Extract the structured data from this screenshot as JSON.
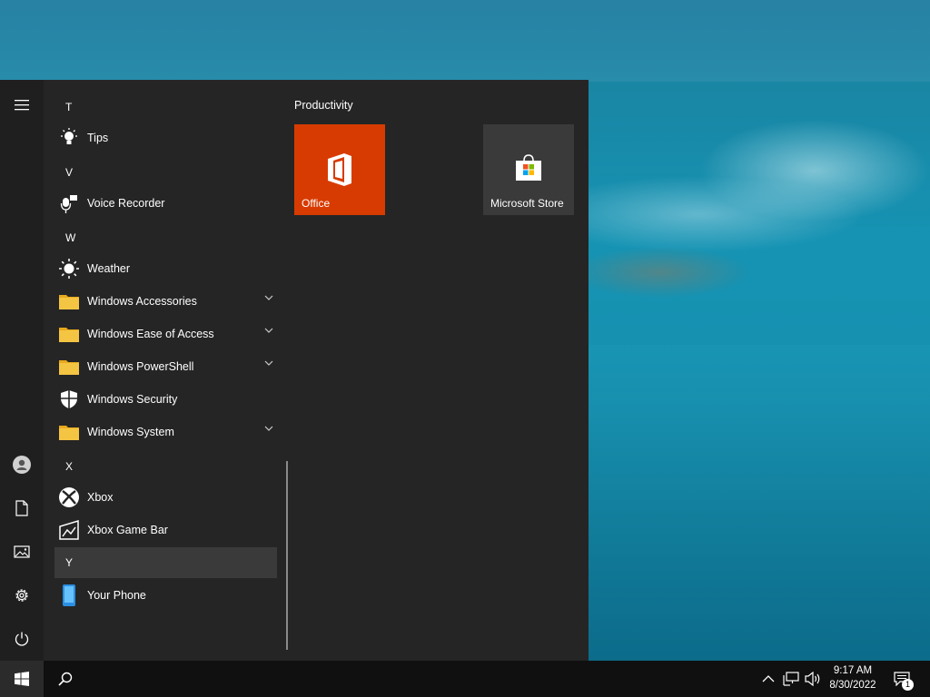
{
  "start_menu": {
    "app_list": [
      {
        "type": "letter",
        "text": "T"
      },
      {
        "type": "app",
        "label": "Tips",
        "icon": "lightbulb-icon"
      },
      {
        "type": "letter",
        "text": "V"
      },
      {
        "type": "app",
        "label": "Voice Recorder",
        "icon": "microphone-icon"
      },
      {
        "type": "letter",
        "text": "W"
      },
      {
        "type": "app",
        "label": "Weather",
        "icon": "sun-icon"
      },
      {
        "type": "folder",
        "label": "Windows Accessories",
        "icon": "folder-icon"
      },
      {
        "type": "folder",
        "label": "Windows Ease of Access",
        "icon": "folder-icon"
      },
      {
        "type": "folder",
        "label": "Windows PowerShell",
        "icon": "folder-icon"
      },
      {
        "type": "app",
        "label": "Windows Security",
        "icon": "shield-icon"
      },
      {
        "type": "folder",
        "label": "Windows System",
        "icon": "folder-icon"
      },
      {
        "type": "letter",
        "text": "X"
      },
      {
        "type": "app",
        "label": "Xbox",
        "icon": "xbox-icon"
      },
      {
        "type": "app",
        "label": "Xbox Game Bar",
        "icon": "game-bar-icon"
      },
      {
        "type": "letter",
        "text": "Y",
        "highlighted": true
      },
      {
        "type": "app",
        "label": "Your Phone",
        "icon": "phone-icon"
      }
    ],
    "tiles_group": {
      "title": "Productivity",
      "tiles": [
        {
          "label": "Office",
          "color": "#d83b01",
          "icon": "office-icon"
        },
        {
          "label": "Microsoft Store",
          "color": "#3a3a3a",
          "icon": "store-bag-icon"
        }
      ]
    },
    "rail_icons": [
      "hamburger-menu-icon",
      "user-account-icon",
      "documents-icon",
      "pictures-icon",
      "settings-gear-icon",
      "power-icon"
    ]
  },
  "taskbar": {
    "time": "9:17 AM",
    "date": "8/30/2022",
    "notification_count": "1"
  },
  "colors": {
    "menu_bg": "#252525",
    "rail_bg": "#1f1f1f",
    "accent_office": "#d83b01",
    "folder_yellow": "#f4c542",
    "taskbar_bg": "#101010"
  }
}
